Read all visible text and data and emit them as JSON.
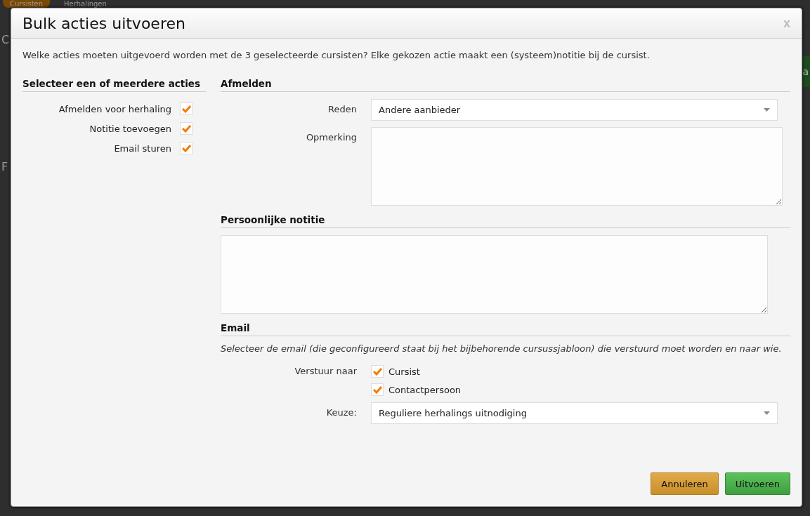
{
  "background": {
    "tabs": [
      {
        "label": "Cursisten",
        "selected": true
      },
      {
        "label": "Herhalingen",
        "selected": false
      }
    ],
    "fragments": [
      "C",
      "F"
    ],
    "side_button": "a"
  },
  "dialog": {
    "title": "Bulk acties uitvoeren",
    "close": "x",
    "intro": "Welke acties moeten uitgevoerd worden met de 3 geselecteerde cursisten? Elke gekozen actie maakt een (systeem)notitie bij de cursist.",
    "actions": {
      "heading": "Selecteer een of meerdere acties",
      "items": [
        {
          "label": "Afmelden voor herhaling",
          "checked": true
        },
        {
          "label": "Notitie toevoegen",
          "checked": true
        },
        {
          "label": "Email sturen",
          "checked": true
        }
      ]
    },
    "afmelden": {
      "heading": "Afmelden",
      "reason": {
        "label": "Reden",
        "value": "Andere aanbieder"
      },
      "remark": {
        "label": "Opmerking"
      }
    },
    "note": {
      "heading": "Persoonlijke notitie"
    },
    "email": {
      "heading": "Email",
      "hint": "Selecteer de email (die geconfigureerd staat bij het bijbehorende cursussjabloon) die verstuurd moet worden en naar wie.",
      "recipients": {
        "label": "Verstuur naar",
        "options": [
          {
            "label": "Cursist",
            "checked": true
          },
          {
            "label": "Contactpersoon",
            "checked": true
          }
        ]
      },
      "choice": {
        "label": "Keuze:",
        "value": "Reguliere herhalings uitnodiging"
      }
    },
    "buttons": [
      {
        "label": "Annuleren",
        "kind": "cancel"
      },
      {
        "label": "Uitvoeren",
        "kind": "confirm"
      }
    ]
  }
}
